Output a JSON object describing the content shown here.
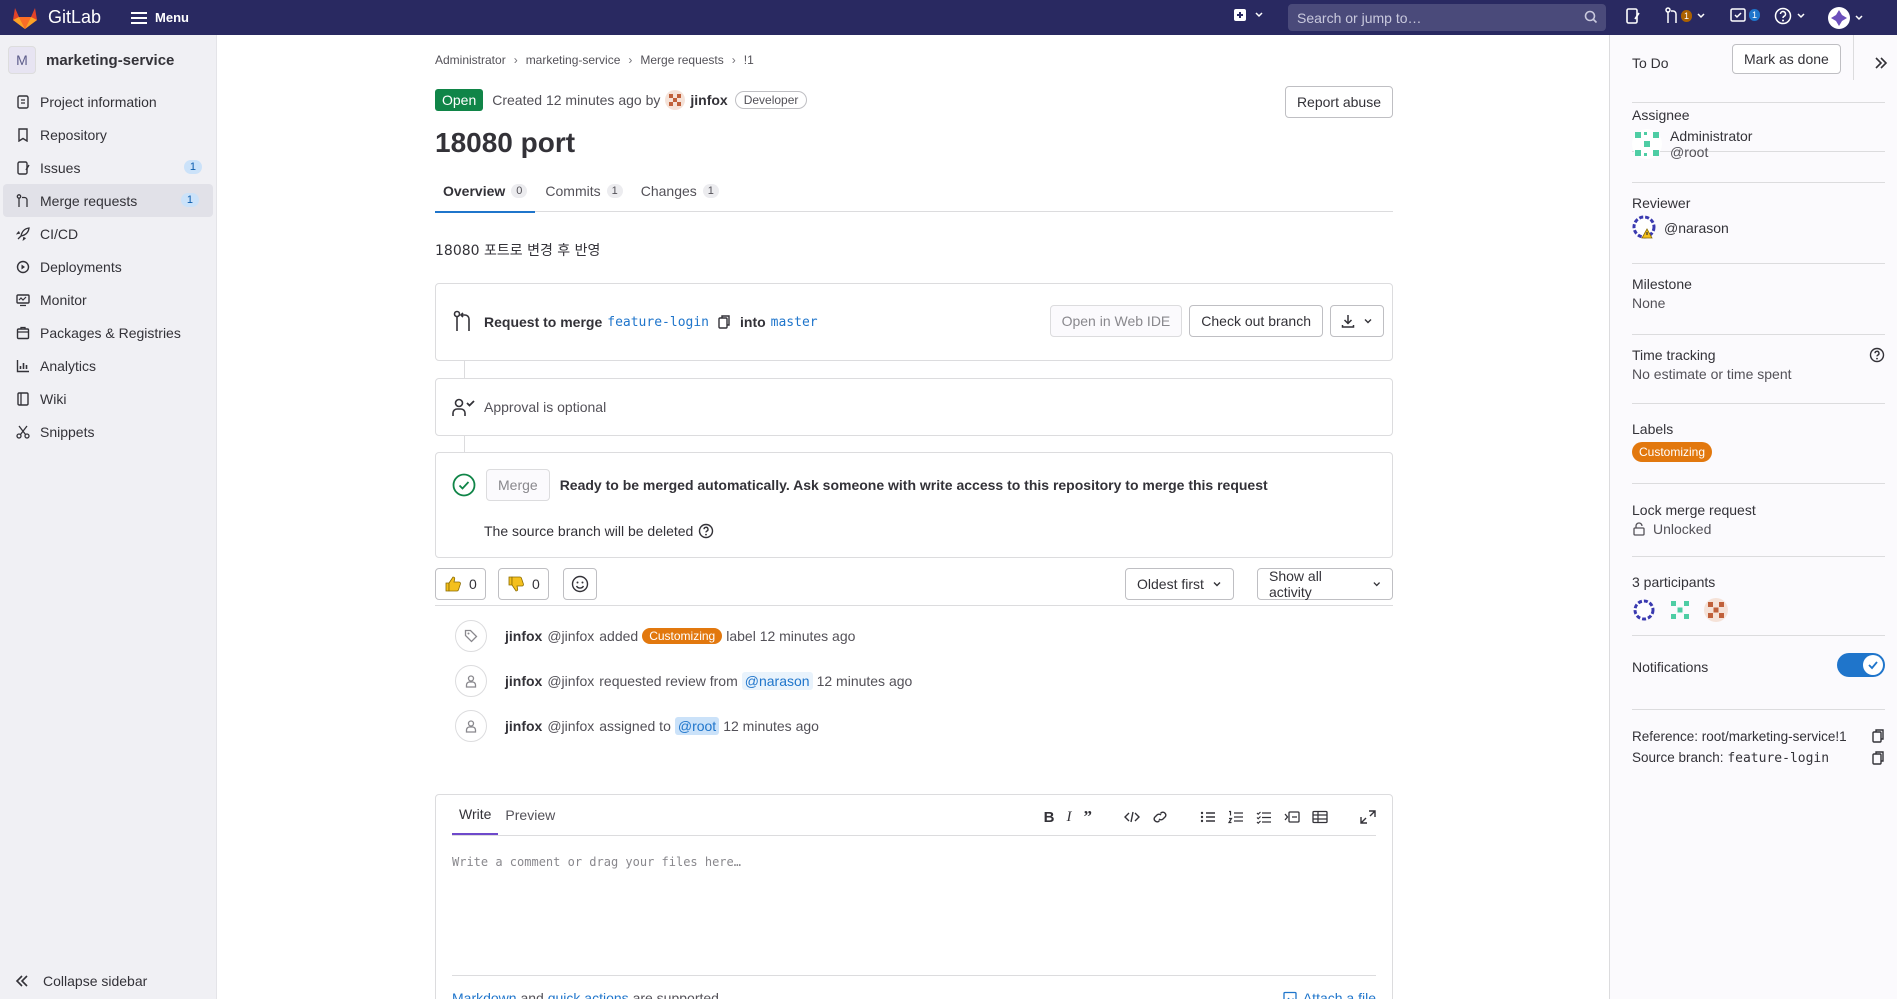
{
  "topbar": {
    "app_name": "GitLab",
    "menu_label": "Menu",
    "search_placeholder": "Search or jump to…",
    "mr_count": "1",
    "todo_count": "1"
  },
  "sidebar": {
    "project_initial": "M",
    "project_name": "marketing-service",
    "items": [
      {
        "label": "Project information",
        "icon": "info-icon"
      },
      {
        "label": "Repository",
        "icon": "repository-icon"
      },
      {
        "label": "Issues",
        "icon": "issues-icon",
        "badge": "1"
      },
      {
        "label": "Merge requests",
        "icon": "merge-request-icon",
        "badge": "1"
      },
      {
        "label": "CI/CD",
        "icon": "rocket-icon"
      },
      {
        "label": "Deployments",
        "icon": "deployments-icon"
      },
      {
        "label": "Monitor",
        "icon": "monitor-icon"
      },
      {
        "label": "Packages & Registries",
        "icon": "package-icon"
      },
      {
        "label": "Analytics",
        "icon": "chart-icon"
      },
      {
        "label": "Wiki",
        "icon": "book-icon"
      },
      {
        "label": "Snippets",
        "icon": "snippet-icon"
      }
    ],
    "collapse_label": "Collapse sidebar"
  },
  "breadcrumbs": [
    "Administrator",
    "marketing-service",
    "Merge requests",
    "!1"
  ],
  "mr": {
    "status": "Open",
    "created_text": "Created 12 minutes ago by",
    "author": "jinfox",
    "author_role": "Developer",
    "report_label": "Report abuse",
    "title": "18080 port",
    "tabs": [
      {
        "label": "Overview",
        "count": "0"
      },
      {
        "label": "Commits",
        "count": "1"
      },
      {
        "label": "Changes",
        "count": "1"
      }
    ],
    "description": "18080 포트로 변경 후 반영"
  },
  "merge_widget": {
    "request_label": "Request to merge",
    "source_branch": "feature-login",
    "into_label": "into",
    "target_branch": "master",
    "open_web_ide": "Open in Web IDE",
    "checkout": "Check out branch",
    "approval_text": "Approval is optional",
    "merge_button": "Merge",
    "ready_text": "Ready to be merged automatically. Ask someone with write access to this repository to merge this request",
    "source_deleted": "The source branch will be deleted"
  },
  "reactions": {
    "thumbs_up": "0",
    "thumbs_down": "0",
    "sort_label": "Oldest first",
    "filter_label": "Show all activity"
  },
  "activity": [
    {
      "author": "jinfox",
      "handle": "@jinfox",
      "pre": "added",
      "label": "Customizing",
      "post": "label 12 minutes ago"
    },
    {
      "author": "jinfox",
      "handle": "@jinfox",
      "pre": "requested review from",
      "mention": "@narason",
      "post": "12 minutes ago"
    },
    {
      "author": "jinfox",
      "handle": "@jinfox",
      "pre": "assigned to",
      "mention": "@root",
      "post": "12 minutes ago"
    }
  ],
  "editor": {
    "write_tab": "Write",
    "preview_tab": "Preview",
    "placeholder": "Write a comment or drag your files here…",
    "markdown_link": "Markdown",
    "and": "and",
    "quick_actions": "quick actions",
    "supported": "are supported",
    "attach": "Attach a file"
  },
  "right_sidebar": {
    "todo_label": "To Do",
    "mark_done": "Mark as done",
    "assignee_title": "Assignee",
    "assignee_name": "Administrator",
    "assignee_handle": "@root",
    "reviewer_title": "Reviewer",
    "reviewer_handle": "@narason",
    "milestone_title": "Milestone",
    "milestone_value": "None",
    "time_title": "Time tracking",
    "time_value": "No estimate or time spent",
    "labels_title": "Labels",
    "label_value": "Customizing",
    "lock_title": "Lock merge request",
    "lock_value": "Unlocked",
    "participants_title": "3 participants",
    "notifications_title": "Notifications",
    "reference": "Reference: root/marketing-service!1",
    "source_branch_label": "Source branch:",
    "source_branch_value": "feature-login"
  },
  "colors": {
    "topbar": "#292961",
    "open_badge": "#108548",
    "label": "#e2780e",
    "link": "#1f75cb"
  }
}
